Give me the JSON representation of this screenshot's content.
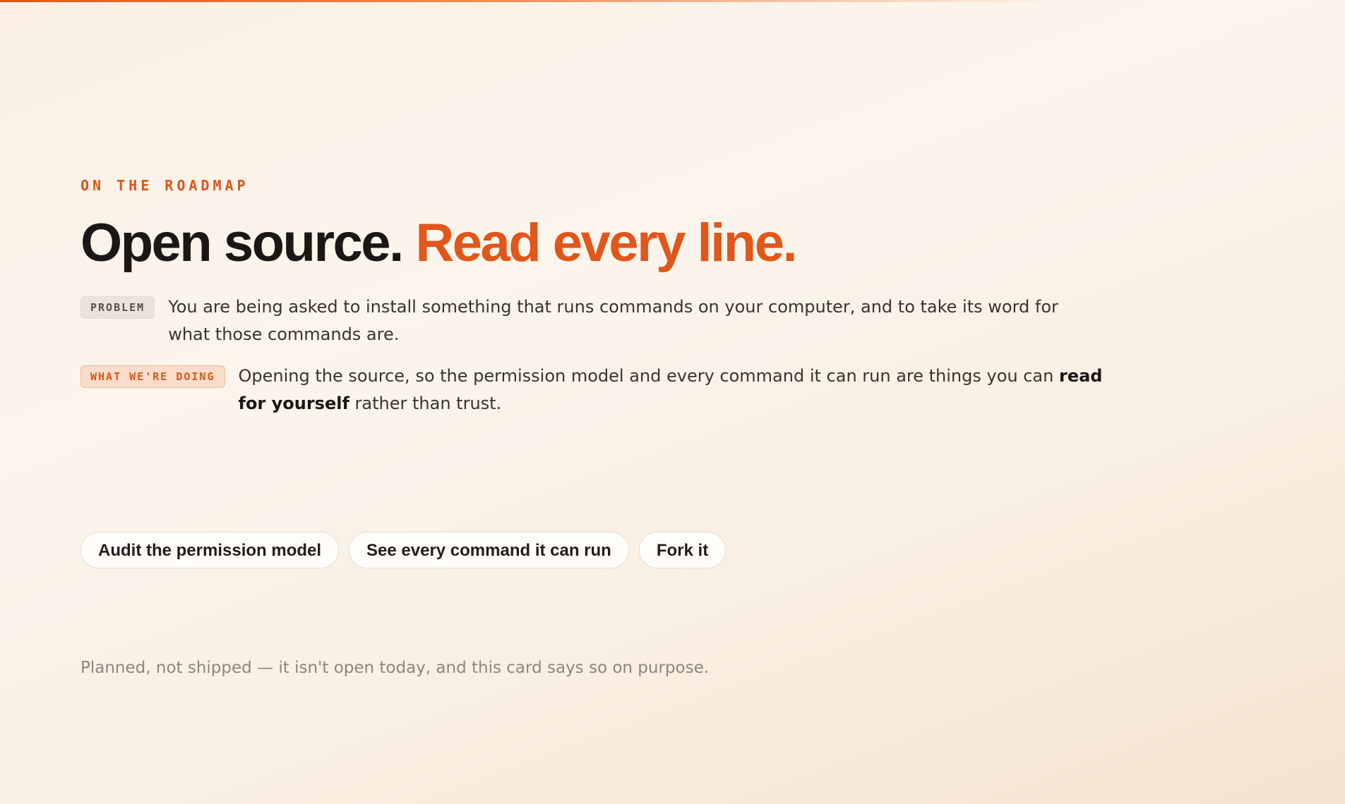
{
  "card": {
    "eyebrow": "ON THE ROADMAP",
    "headline_main": "Open source.",
    "headline_accent": "Read every line.",
    "problem": {
      "badge": "PROBLEM",
      "text": "You are being asked to install something that runs commands on your computer, and to take its word for what those commands are."
    },
    "doing": {
      "badge": "WHAT WE'RE DOING",
      "text_before": "Opening the source, so the permission model and every command it can run are things you can ",
      "text_bold": "read for yourself",
      "text_after": " rather than trust."
    },
    "actions": {
      "audit_label": "Audit the permission model",
      "commands_label": "See every command it can run",
      "fork_label": "Fork it"
    },
    "footnote": "Planned, not shipped — it isn't open today, and this card says so on purpose."
  },
  "colors": {
    "accent": "#e0561b",
    "text": "#1b1714",
    "muted": "#8e857e"
  }
}
